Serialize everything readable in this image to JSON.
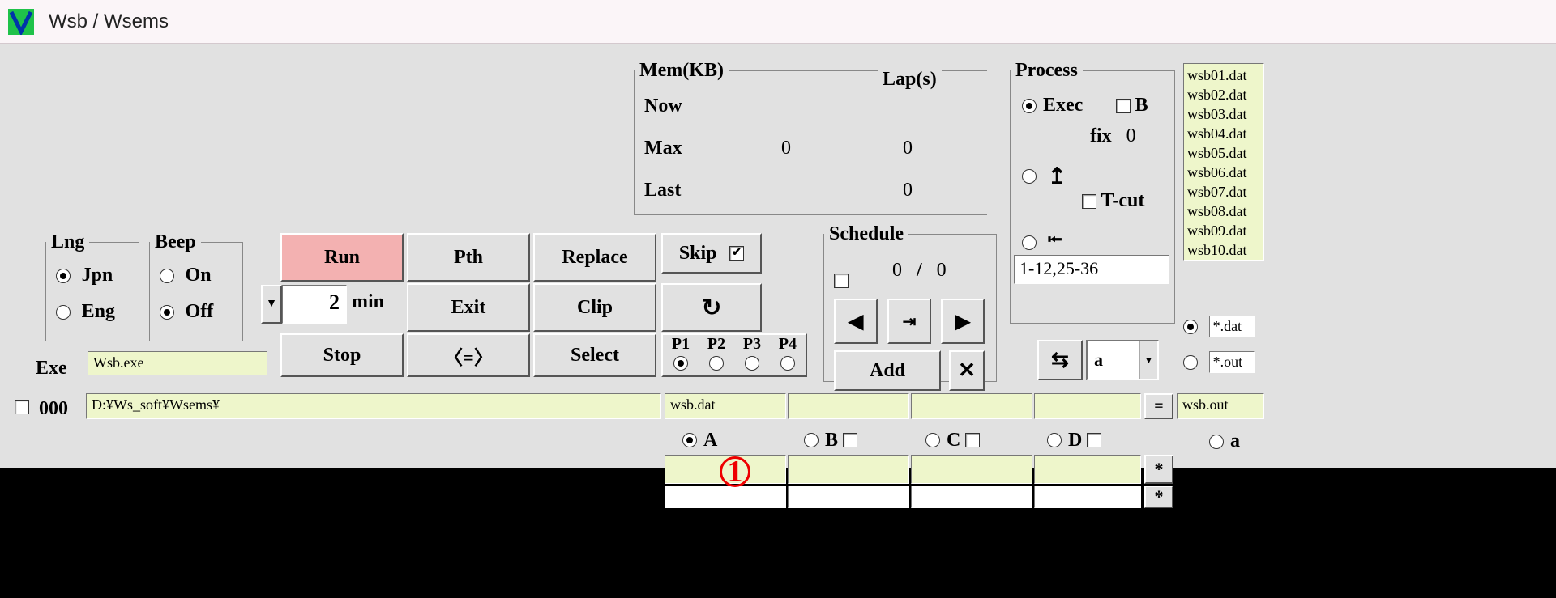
{
  "window": {
    "title": "Wsb / Wsems"
  },
  "lng": {
    "legend": "Lng",
    "jpn": "Jpn",
    "eng": "Eng",
    "selected": "jpn"
  },
  "beep": {
    "legend": "Beep",
    "on": "On",
    "off": "Off",
    "selected": "off"
  },
  "spin": {
    "value": "2",
    "unit": "min"
  },
  "buttons": {
    "run": "Run",
    "pth": "Pth",
    "replace": "Replace",
    "exit": "Exit",
    "clip": "Clip",
    "stop": "Stop",
    "swap": "〈=〉",
    "select": "Select",
    "reload": "↻"
  },
  "skip": {
    "label": "Skip",
    "checked": true
  },
  "p_group": {
    "labels": [
      "P1",
      "P2",
      "P3",
      "P4"
    ],
    "selected": 0
  },
  "mem": {
    "legend_mem": "Mem(KB)",
    "legend_lap": "Lap(s)",
    "rows": [
      "Now",
      "Max",
      "Last"
    ],
    "mem_vals": [
      "",
      "0",
      ""
    ],
    "lap_vals": [
      "",
      "0",
      "0"
    ]
  },
  "schedule": {
    "legend": "Schedule",
    "cur": "0",
    "tot": "0",
    "add": "Add",
    "close": "✕",
    "prev": "◀",
    "next": "▶",
    "mid": "⇥"
  },
  "process": {
    "legend": "Process",
    "exec": "Exec",
    "b": "B",
    "fix_label": "fix",
    "fix_val": "0",
    "tcut": "T-cut",
    "range": "1-12,25-36",
    "swap_icon": "⇆",
    "combo_val": "a"
  },
  "exe": {
    "label": "Exe",
    "value": "Wsb.exe"
  },
  "row000": {
    "num": "000",
    "path": "D:¥Ws_soft¥Wsems¥",
    "dat": "wsb.dat",
    "eq": "=",
    "out": "wsb.out"
  },
  "abcd": {
    "items": [
      "A",
      "B",
      "C",
      "D"
    ],
    "selected": 0,
    "a_lower": "a",
    "star": "*"
  },
  "filelist": [
    "wsb01.dat",
    "wsb02.dat",
    "wsb03.dat",
    "wsb04.dat",
    "wsb05.dat",
    "wsb06.dat",
    "wsb07.dat",
    "wsb08.dat",
    "wsb09.dat",
    "wsb10.dat"
  ],
  "ext_filter": {
    "dat": "*.dat",
    "out": "*.out",
    "selected": "dat"
  },
  "annotation": {
    "one": "1"
  }
}
